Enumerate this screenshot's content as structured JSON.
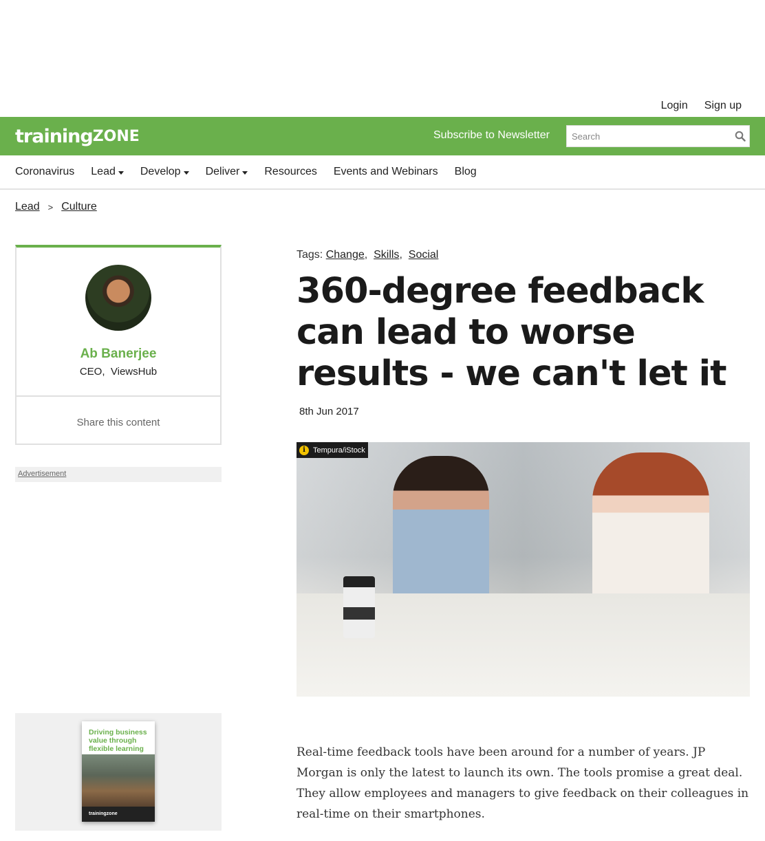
{
  "header": {
    "login_label": "Login",
    "signup_label": "Sign up",
    "logo_text_main": "training",
    "logo_text_zone": "ZONE",
    "subscribe_label": "Subscribe to Newsletter",
    "search_placeholder": "Search",
    "brand_color": "#6ab04c"
  },
  "nav": {
    "items": [
      {
        "label": "Coronavirus",
        "has_dropdown": false
      },
      {
        "label": "Lead",
        "has_dropdown": true
      },
      {
        "label": "Develop",
        "has_dropdown": true
      },
      {
        "label": "Deliver",
        "has_dropdown": true
      },
      {
        "label": "Resources",
        "has_dropdown": false
      },
      {
        "label": "Events and Webinars",
        "has_dropdown": false
      },
      {
        "label": "Blog",
        "has_dropdown": false
      }
    ]
  },
  "breadcrumb": {
    "items": [
      "Lead",
      "Culture"
    ],
    "separator": ">"
  },
  "author": {
    "name": "Ab Banerjee",
    "role": "CEO",
    "company": "ViewsHub",
    "share_label": "Share this content"
  },
  "sidebar": {
    "ad_label": "Advertisement",
    "promo_title": "Driving business value through flexible learning",
    "promo_brand": "trainingzone"
  },
  "article": {
    "tags_label": "Tags:",
    "tags": [
      "Change",
      "Skills",
      "Social"
    ],
    "title": "360-degree feedback can lead to worse results - we can't let it",
    "date": "8th Jun 2017",
    "image_credit": "Tempura/iStock",
    "lead_paragraph": "Real-time feedback tools have been around for a number of years. JP Morgan is only the latest to launch its own. The tools promise a great deal. They allow employees and managers to give feedback on their colleagues in real-time on their smartphones."
  }
}
